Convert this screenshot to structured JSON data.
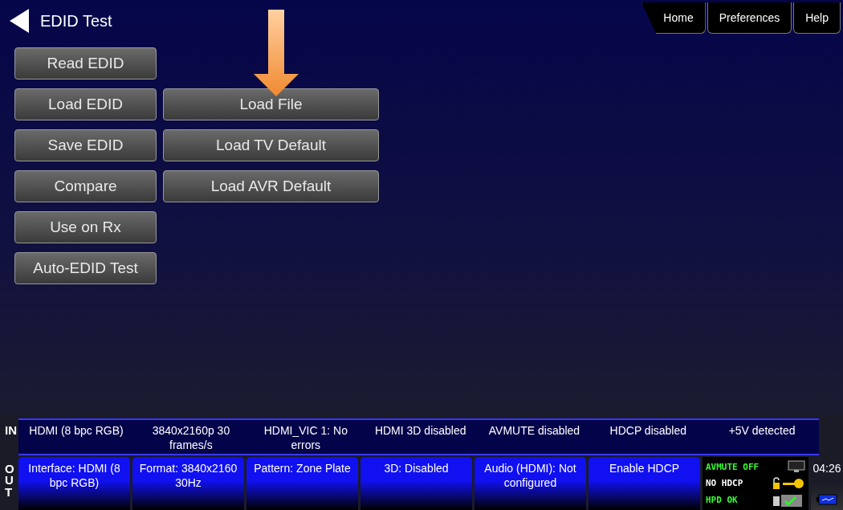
{
  "header": {
    "title": "EDID Test"
  },
  "nav_tabs": [
    {
      "label": "Home"
    },
    {
      "label": "Preferences"
    },
    {
      "label": "Help"
    }
  ],
  "left_buttons": [
    {
      "label": "Read EDID"
    },
    {
      "label": "Load EDID"
    },
    {
      "label": "Save EDID"
    },
    {
      "label": "Compare"
    },
    {
      "label": "Use on Rx"
    },
    {
      "label": "Auto-EDID Test"
    }
  ],
  "right_buttons": [
    {
      "label": "Load File"
    },
    {
      "label": "Load TV Default"
    },
    {
      "label": "Load AVR Default"
    }
  ],
  "input_status": {
    "label": "IN",
    "cells": [
      "HDMI (8 bpc RGB)",
      "3840x2160p 30 frames/s",
      "HDMI_VIC 1: No errors",
      "HDMI 3D disabled",
      "AVMUTE disabled",
      "HDCP disabled",
      "+5V detected"
    ]
  },
  "output_status": {
    "label": "OUT",
    "buttons": [
      "Interface: HDMI (8 bpc RGB)",
      "Format: 3840x2160 30Hz",
      "Pattern: Zone Plate",
      "3D: Disabled",
      "Audio (HDMI): Not configured",
      "Enable HDCP"
    ]
  },
  "indicators": [
    {
      "text": "AVMUTE OFF",
      "color": "#33ff33",
      "kind": "monitor"
    },
    {
      "text": "NO HDCP",
      "color": "#ffffff",
      "kind": "key"
    },
    {
      "text": "HPD OK",
      "color": "#33ff33",
      "kind": "plug"
    }
  ],
  "clock": "04:26"
}
